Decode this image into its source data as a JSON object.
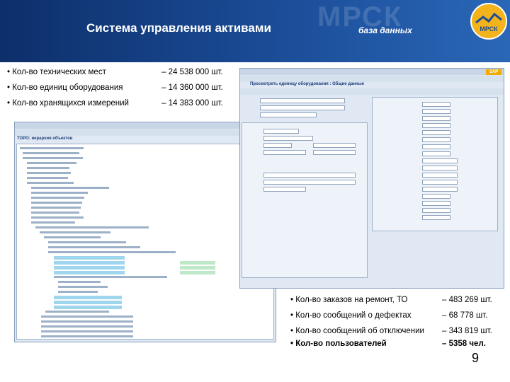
{
  "header": {
    "title": "Система управления активами",
    "subtitle": "база данных",
    "watermark": "МРСК",
    "logo_text": "МРСК"
  },
  "stats_top": [
    {
      "label": "• Кол-во технических мест",
      "value": "– 24 538 000 шт."
    },
    {
      "label": "• Кол-во единиц оборудования",
      "value": "– 14 360 000 шт."
    },
    {
      "label": "• Кол-во хранящихся измерений",
      "value": "– 14 383 000 шт."
    }
  ],
  "screens": {
    "tree_title": "ТОРО: иерархия объектов",
    "form_title": "Просмотреть единицу оборудования : Общие данные",
    "sap_logo": "SAP"
  },
  "stats_bottom": [
    {
      "label": "• Кол-во заказов на ремонт, ТО",
      "value": "– 483 269 шт."
    },
    {
      "label": "• Кол-во сообщений о дефектах",
      "value": "– 68 778 шт."
    },
    {
      "label": "• Кол-во сообщений об отключении",
      "value": "– 343 819 шт."
    },
    {
      "label": "• Кол-во пользователей",
      "value": "– 5358 чел."
    }
  ],
  "page_number": "9",
  "colors": {
    "header_dark": "#0d2f6a",
    "header_light": "#2a67b7",
    "highlight": "#9fd6ee"
  }
}
